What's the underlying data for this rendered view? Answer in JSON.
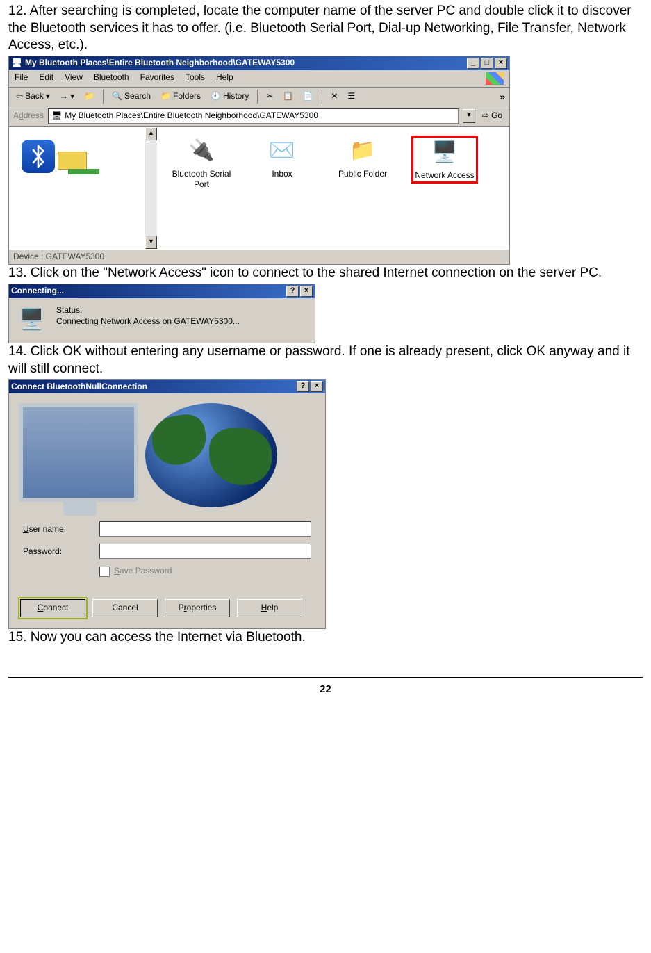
{
  "steps": {
    "s12": "12. After searching is completed, locate the computer name of the server PC and double click it to discover the Bluetooth services it has to offer. (i.e. Bluetooth Serial Port, Dial-up Networking, File Transfer, Network Access, etc.).",
    "s13": "13. Click on the \"Network Access\" icon to connect to the shared Internet connection on the server PC.",
    "s14": "14. Click OK without entering any username or password. If one is already present, click OK anyway and it will still connect.",
    "s15": "15. Now you can access the Internet via Bluetooth."
  },
  "win1": {
    "title": "My Bluetooth Places\\Entire Bluetooth Neighborhood\\GATEWAY5300",
    "menu": {
      "file": "File",
      "edit": "Edit",
      "view": "View",
      "bluetooth": "Bluetooth",
      "favorites": "Favorites",
      "tools": "Tools",
      "help": "Help"
    },
    "toolbar": {
      "back": "Back",
      "search": "Search",
      "folders": "Folders",
      "history": "History"
    },
    "address_label": "Address",
    "address_value": "My Bluetooth Places\\Entire Bluetooth Neighborhood\\GATEWAY5300",
    "go": "Go",
    "more": "»",
    "icons": {
      "serial": "Bluetooth Serial Port",
      "inbox": "Inbox",
      "public": "Public Folder",
      "network": "Network Access"
    },
    "status": "Device : GATEWAY5300"
  },
  "win2": {
    "title": "Connecting...",
    "status_label": "Status:",
    "status_text": "Connecting Network Access on GATEWAY5300..."
  },
  "win3": {
    "title": "Connect BluetoothNullConnection",
    "user_label": "User name:",
    "pass_label": "Password:",
    "save_label": "Save Password",
    "buttons": {
      "connect": "Connect",
      "cancel": "Cancel",
      "properties": "Properties",
      "help": "Help"
    }
  },
  "page_number": "22"
}
